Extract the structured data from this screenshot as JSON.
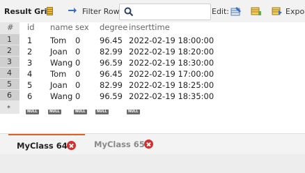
{
  "toolbar": {
    "result_grid_label": "Result Grid",
    "filter_rows_label": "Filter Rows:",
    "filter_value": "",
    "edit_label": "Edit:",
    "export_label": "Expor"
  },
  "grid": {
    "columns": [
      "#",
      "id",
      "name",
      "sex",
      "degree",
      "inserttime"
    ],
    "rows": [
      {
        "rownum": "1",
        "id": "1",
        "name": "Tom",
        "sex": "0",
        "degree": "96.45",
        "inserttime": "2022-02-19 18:00:00"
      },
      {
        "rownum": "2",
        "id": "2",
        "name": "Joan",
        "sex": "0",
        "degree": "82.99",
        "inserttime": "2022-02-19 18:20:00"
      },
      {
        "rownum": "3",
        "id": "3",
        "name": "Wang",
        "sex": "0",
        "degree": "96.59",
        "inserttime": "2022-02-19 18:30:00"
      },
      {
        "rownum": "4",
        "id": "4",
        "name": "Tom",
        "sex": "0",
        "degree": "96.45",
        "inserttime": "2022-02-19 17:00:00"
      },
      {
        "rownum": "5",
        "id": "5",
        "name": "Joan",
        "sex": "0",
        "degree": "82.99",
        "inserttime": "2022-02-19 18:25:00"
      },
      {
        "rownum": "6",
        "id": "6",
        "name": "Wang",
        "sex": "0",
        "degree": "96.59",
        "inserttime": "2022-02-19 18:35:00"
      }
    ],
    "new_row_marker": "*",
    "null_label": "NULL"
  },
  "tabs": [
    {
      "label": "MyClass 64",
      "active": true
    },
    {
      "label": "MyClass 65",
      "active": false
    }
  ],
  "colors": {
    "active_tab_accent": "#e0601f",
    "close_icon": "#d32f2f",
    "row_number_bg": "#cfcfcf"
  },
  "icons": [
    "grid-icon",
    "swap-icon",
    "search-icon",
    "edit-grid-icon",
    "edit-row-icon",
    "export-icon",
    "close-icon"
  ]
}
